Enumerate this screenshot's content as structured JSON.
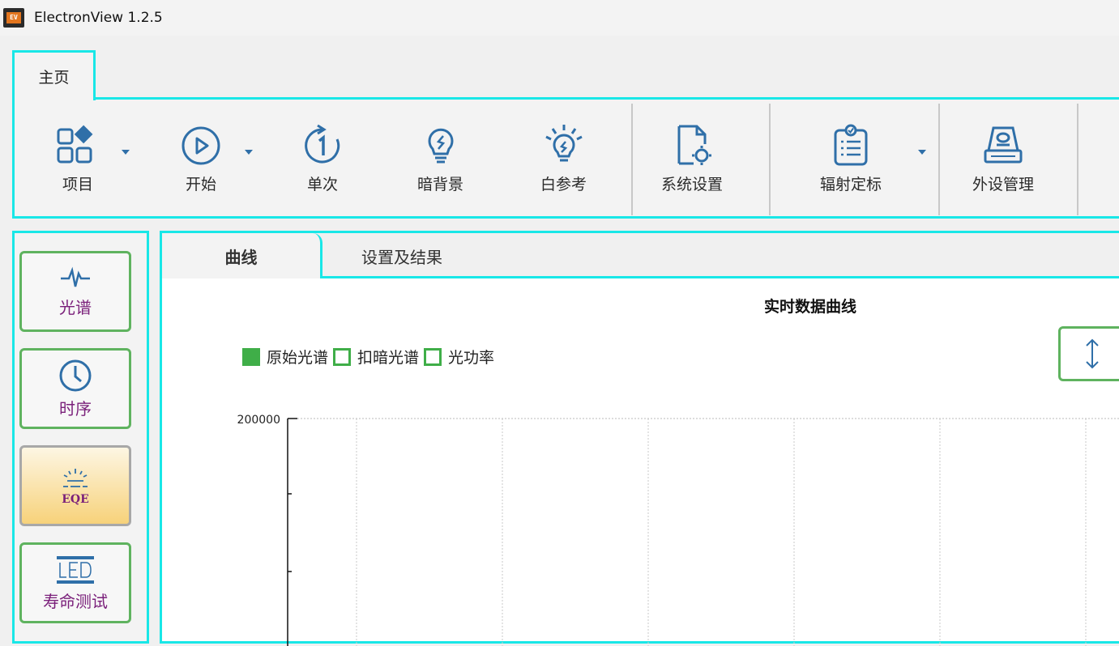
{
  "window": {
    "title": "ElectronView 1.2.5",
    "logo_text": "EV"
  },
  "ribbon": {
    "tab": "主页",
    "buttons": {
      "project": "项目",
      "start": "开始",
      "single": "单次",
      "dark": "暗背景",
      "whiteref": "白参考",
      "settings": "系统设置",
      "calib": "辐射定标",
      "peripheral": "外设管理"
    }
  },
  "sidebar": {
    "spectrum": "光谱",
    "timing": "时序",
    "eqe": "EQE",
    "lifetime": "寿命测试"
  },
  "content_tabs": {
    "curve": "曲线",
    "settings": "设置及结果"
  },
  "chart_data": {
    "type": "line",
    "title": "实时数据曲线",
    "series": [
      {
        "name": "原始光谱",
        "checked": true,
        "color": "#3fae48"
      },
      {
        "name": "扣暗光谱",
        "checked": false,
        "color": "#3fae48"
      },
      {
        "name": "光功率",
        "checked": false,
        "color": "#3fae48"
      }
    ],
    "ylim_top": 200000,
    "y_tick_labels": [
      "200000"
    ],
    "grid": true,
    "legend": "top-left"
  }
}
